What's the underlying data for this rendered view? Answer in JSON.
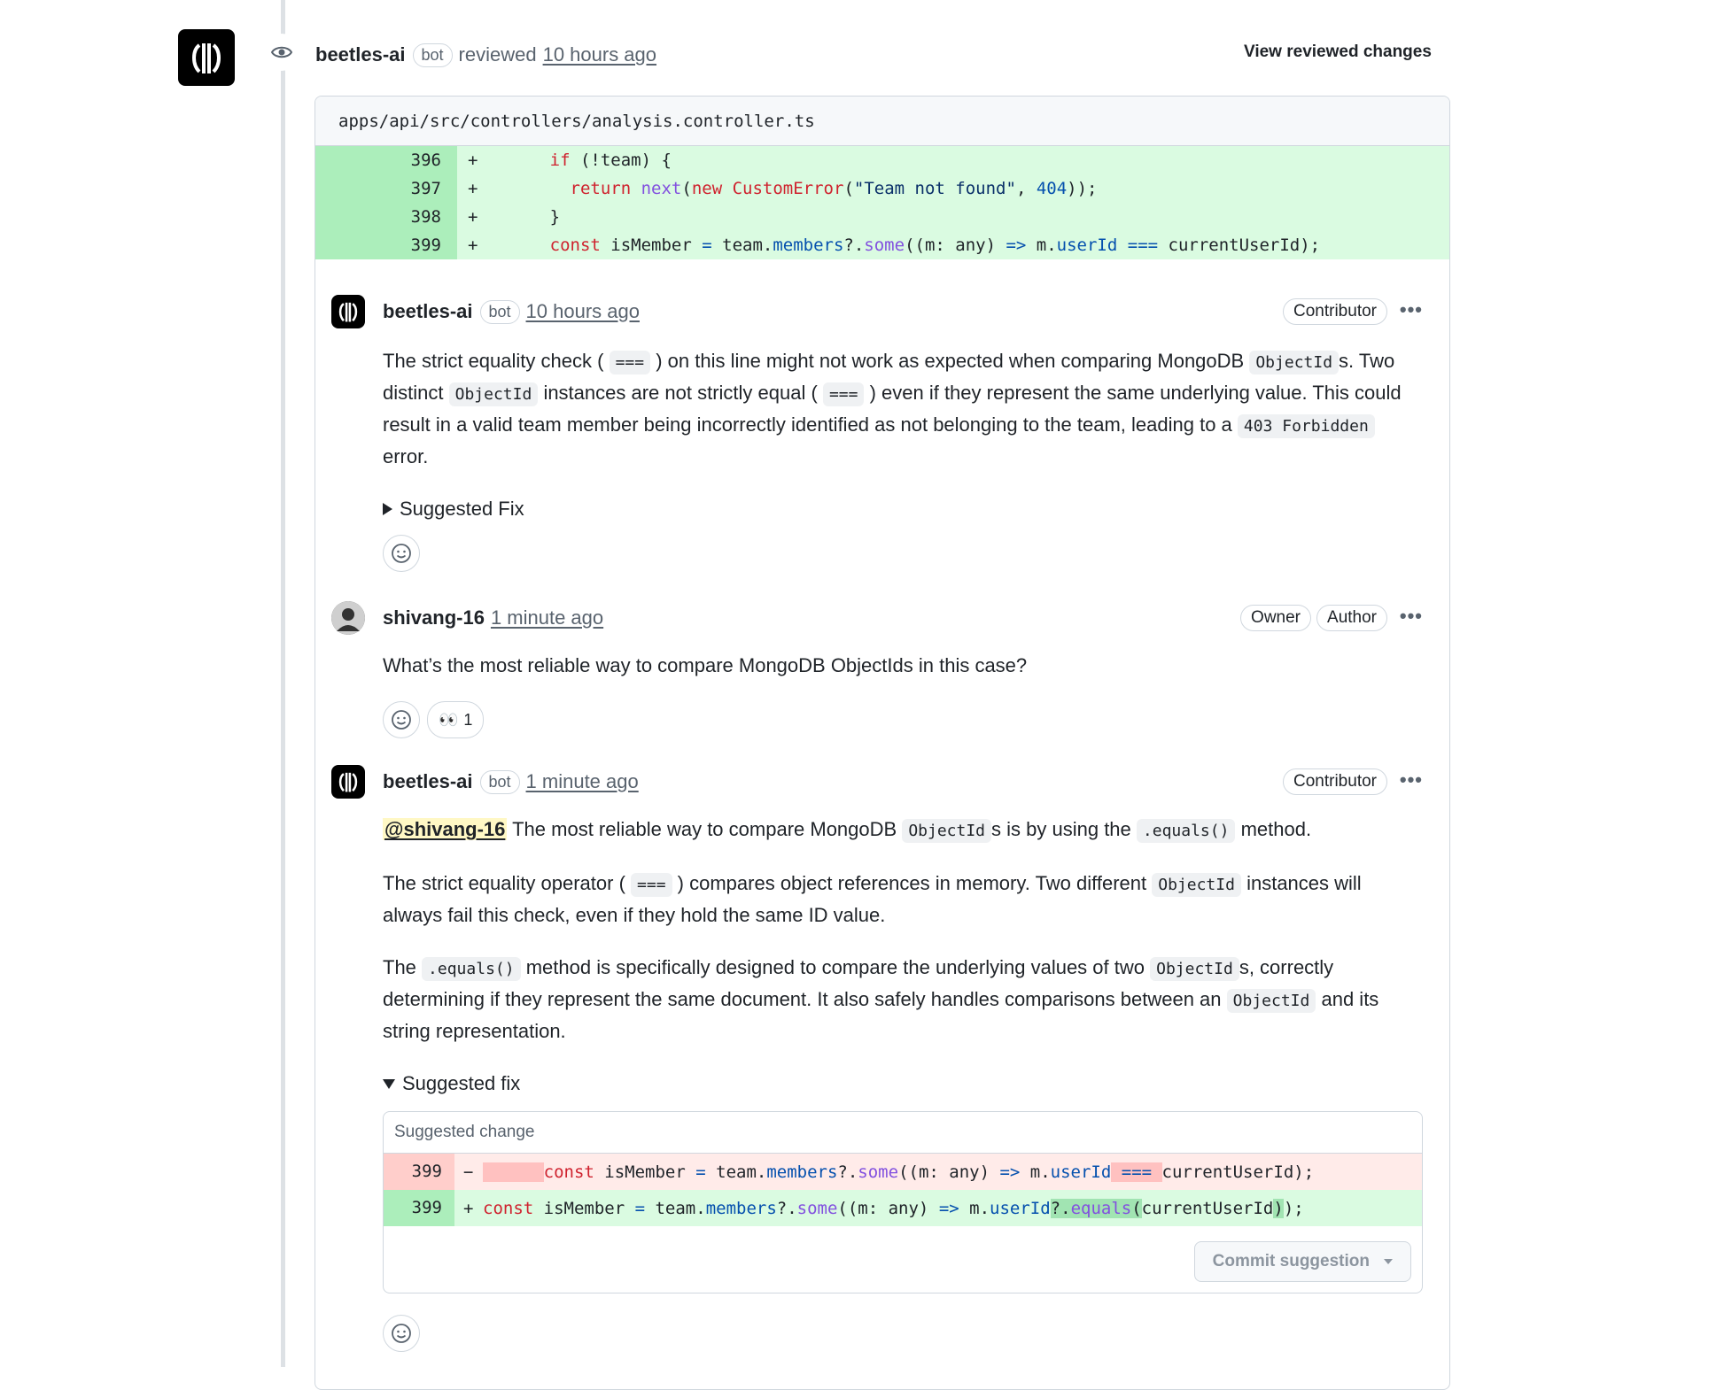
{
  "review": {
    "author": "beetles-ai",
    "bot_label": "bot",
    "action": "reviewed",
    "time": "10 hours ago",
    "view_changes": "View reviewed changes"
  },
  "file": {
    "path": "apps/api/src/controllers/analysis.controller.ts",
    "lines": [
      {
        "num": "396",
        "sign": "+"
      },
      {
        "num": "397",
        "sign": "+"
      },
      {
        "num": "398",
        "sign": "+"
      },
      {
        "num": "399",
        "sign": "+"
      }
    ]
  },
  "comments": [
    {
      "author": "beetles-ai",
      "bot_label": "bot",
      "time": "10 hours ago",
      "roles": [
        "Contributor"
      ],
      "p1_a": "The strict equality check (",
      "code_eq": "===",
      "p1_b": ") on this line might not work as expected when comparing MongoDB",
      "code_objectid": "ObjectId",
      "p1_c": "s. Two distinct",
      "p1_d": "instances are not strictly equal (",
      "p1_e": ") even if they represent the same underlying value. This could result in a valid team member being incorrectly identified as not belonging to the team, leading to a",
      "code_403": "403 Forbidden",
      "p1_f": "error.",
      "summary": "Suggested Fix"
    },
    {
      "author": "shivang-16",
      "time": "1 minute ago",
      "roles": [
        "Owner",
        "Author"
      ],
      "text": "What’s the most reliable way to compare MongoDB ObjectIds in this case?",
      "reaction_emoji": "👀",
      "reaction_count": "1"
    },
    {
      "author": "beetles-ai",
      "bot_label": "bot",
      "time": "1 minute ago",
      "roles": [
        "Contributor"
      ],
      "mention": "@shivang-16",
      "p1_a": "The most reliable way to compare MongoDB",
      "p1_b": "s is by using the",
      "code_equals": ".equals()",
      "p1_c": "method.",
      "p2_a": "The strict equality operator (",
      "p2_b": ") compares object references in memory. Two different",
      "p2_c": "instances will always fail this check, even if they hold the same ID value.",
      "p3_a": "The",
      "p3_b": "method is specifically designed to compare the underlying values of two",
      "p3_c": "s, correctly determining if they represent the same document. It also safely handles comparisons between an",
      "p3_d": "and its string representation.",
      "summary": "Suggested fix",
      "suggestion": {
        "title": "Suggested change",
        "del_num": "399",
        "del_sign": "−",
        "add_num": "399",
        "add_sign": "+",
        "commit_label": "Commit suggestion"
      }
    }
  ]
}
